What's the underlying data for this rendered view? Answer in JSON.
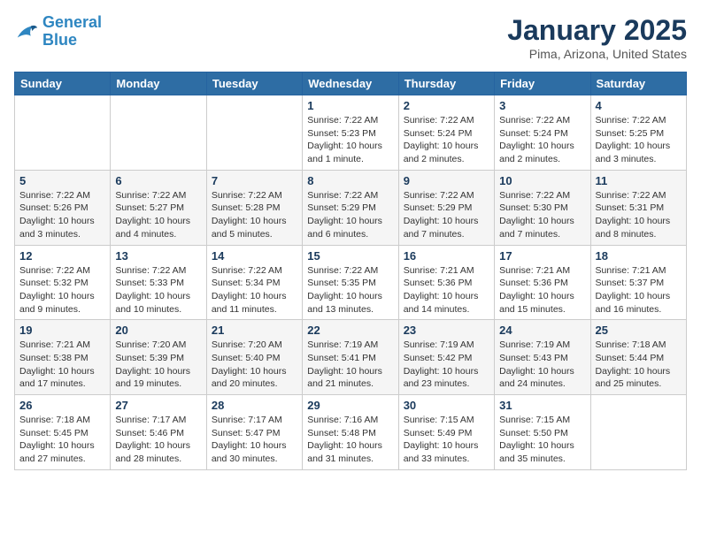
{
  "logo": {
    "line1": "General",
    "line2": "Blue"
  },
  "calendar": {
    "title": "January 2025",
    "subtitle": "Pima, Arizona, United States"
  },
  "days_of_week": [
    "Sunday",
    "Monday",
    "Tuesday",
    "Wednesday",
    "Thursday",
    "Friday",
    "Saturday"
  ],
  "weeks": [
    [
      {
        "day": "",
        "info": ""
      },
      {
        "day": "",
        "info": ""
      },
      {
        "day": "",
        "info": ""
      },
      {
        "day": "1",
        "info": "Sunrise: 7:22 AM\nSunset: 5:23 PM\nDaylight: 10 hours\nand 1 minute."
      },
      {
        "day": "2",
        "info": "Sunrise: 7:22 AM\nSunset: 5:24 PM\nDaylight: 10 hours\nand 2 minutes."
      },
      {
        "day": "3",
        "info": "Sunrise: 7:22 AM\nSunset: 5:24 PM\nDaylight: 10 hours\nand 2 minutes."
      },
      {
        "day": "4",
        "info": "Sunrise: 7:22 AM\nSunset: 5:25 PM\nDaylight: 10 hours\nand 3 minutes."
      }
    ],
    [
      {
        "day": "5",
        "info": "Sunrise: 7:22 AM\nSunset: 5:26 PM\nDaylight: 10 hours\nand 3 minutes."
      },
      {
        "day": "6",
        "info": "Sunrise: 7:22 AM\nSunset: 5:27 PM\nDaylight: 10 hours\nand 4 minutes."
      },
      {
        "day": "7",
        "info": "Sunrise: 7:22 AM\nSunset: 5:28 PM\nDaylight: 10 hours\nand 5 minutes."
      },
      {
        "day": "8",
        "info": "Sunrise: 7:22 AM\nSunset: 5:29 PM\nDaylight: 10 hours\nand 6 minutes."
      },
      {
        "day": "9",
        "info": "Sunrise: 7:22 AM\nSunset: 5:29 PM\nDaylight: 10 hours\nand 7 minutes."
      },
      {
        "day": "10",
        "info": "Sunrise: 7:22 AM\nSunset: 5:30 PM\nDaylight: 10 hours\nand 7 minutes."
      },
      {
        "day": "11",
        "info": "Sunrise: 7:22 AM\nSunset: 5:31 PM\nDaylight: 10 hours\nand 8 minutes."
      }
    ],
    [
      {
        "day": "12",
        "info": "Sunrise: 7:22 AM\nSunset: 5:32 PM\nDaylight: 10 hours\nand 9 minutes."
      },
      {
        "day": "13",
        "info": "Sunrise: 7:22 AM\nSunset: 5:33 PM\nDaylight: 10 hours\nand 10 minutes."
      },
      {
        "day": "14",
        "info": "Sunrise: 7:22 AM\nSunset: 5:34 PM\nDaylight: 10 hours\nand 11 minutes."
      },
      {
        "day": "15",
        "info": "Sunrise: 7:22 AM\nSunset: 5:35 PM\nDaylight: 10 hours\nand 13 minutes."
      },
      {
        "day": "16",
        "info": "Sunrise: 7:21 AM\nSunset: 5:36 PM\nDaylight: 10 hours\nand 14 minutes."
      },
      {
        "day": "17",
        "info": "Sunrise: 7:21 AM\nSunset: 5:36 PM\nDaylight: 10 hours\nand 15 minutes."
      },
      {
        "day": "18",
        "info": "Sunrise: 7:21 AM\nSunset: 5:37 PM\nDaylight: 10 hours\nand 16 minutes."
      }
    ],
    [
      {
        "day": "19",
        "info": "Sunrise: 7:21 AM\nSunset: 5:38 PM\nDaylight: 10 hours\nand 17 minutes."
      },
      {
        "day": "20",
        "info": "Sunrise: 7:20 AM\nSunset: 5:39 PM\nDaylight: 10 hours\nand 19 minutes."
      },
      {
        "day": "21",
        "info": "Sunrise: 7:20 AM\nSunset: 5:40 PM\nDaylight: 10 hours\nand 20 minutes."
      },
      {
        "day": "22",
        "info": "Sunrise: 7:19 AM\nSunset: 5:41 PM\nDaylight: 10 hours\nand 21 minutes."
      },
      {
        "day": "23",
        "info": "Sunrise: 7:19 AM\nSunset: 5:42 PM\nDaylight: 10 hours\nand 23 minutes."
      },
      {
        "day": "24",
        "info": "Sunrise: 7:19 AM\nSunset: 5:43 PM\nDaylight: 10 hours\nand 24 minutes."
      },
      {
        "day": "25",
        "info": "Sunrise: 7:18 AM\nSunset: 5:44 PM\nDaylight: 10 hours\nand 25 minutes."
      }
    ],
    [
      {
        "day": "26",
        "info": "Sunrise: 7:18 AM\nSunset: 5:45 PM\nDaylight: 10 hours\nand 27 minutes."
      },
      {
        "day": "27",
        "info": "Sunrise: 7:17 AM\nSunset: 5:46 PM\nDaylight: 10 hours\nand 28 minutes."
      },
      {
        "day": "28",
        "info": "Sunrise: 7:17 AM\nSunset: 5:47 PM\nDaylight: 10 hours\nand 30 minutes."
      },
      {
        "day": "29",
        "info": "Sunrise: 7:16 AM\nSunset: 5:48 PM\nDaylight: 10 hours\nand 31 minutes."
      },
      {
        "day": "30",
        "info": "Sunrise: 7:15 AM\nSunset: 5:49 PM\nDaylight: 10 hours\nand 33 minutes."
      },
      {
        "day": "31",
        "info": "Sunrise: 7:15 AM\nSunset: 5:50 PM\nDaylight: 10 hours\nand 35 minutes."
      },
      {
        "day": "",
        "info": ""
      }
    ]
  ]
}
